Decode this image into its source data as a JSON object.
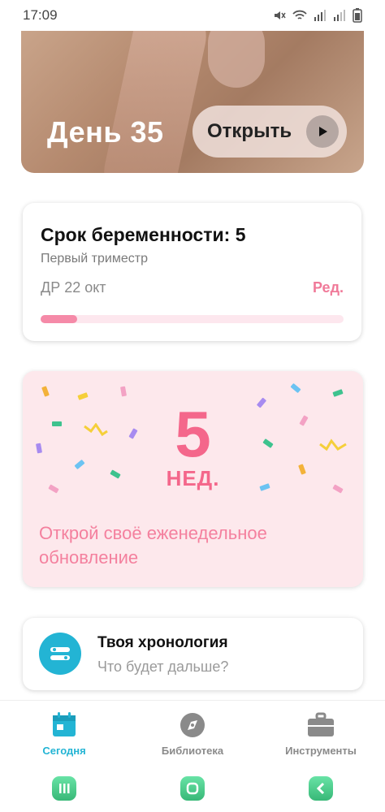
{
  "status": {
    "time": "17:09"
  },
  "hero": {
    "day_label": "День 35",
    "open_label": "Открыть"
  },
  "pregnancy": {
    "title": "Срок беременности: 5",
    "trimester": "Первый триместр",
    "due_date": "ДР 22 окт",
    "edit_label": "Ред.",
    "progress": 0.12
  },
  "week_update": {
    "week_number": "5",
    "week_unit": "НЕД.",
    "cta": "Открой своё еженедельное обновление"
  },
  "timeline": {
    "title": "Твоя хронология",
    "subtitle": "Что будет дальше?"
  },
  "bottom_nav": [
    {
      "label": "Сегодня",
      "icon": "calendar-icon",
      "active": true
    },
    {
      "label": "Библиотека",
      "icon": "compass-icon",
      "active": false
    },
    {
      "label": "Инструменты",
      "icon": "toolbox-icon",
      "active": false
    }
  ],
  "colors": {
    "accent": "#23b4d4",
    "pink": "#f4678b",
    "inactive": "#8a8a8a"
  }
}
